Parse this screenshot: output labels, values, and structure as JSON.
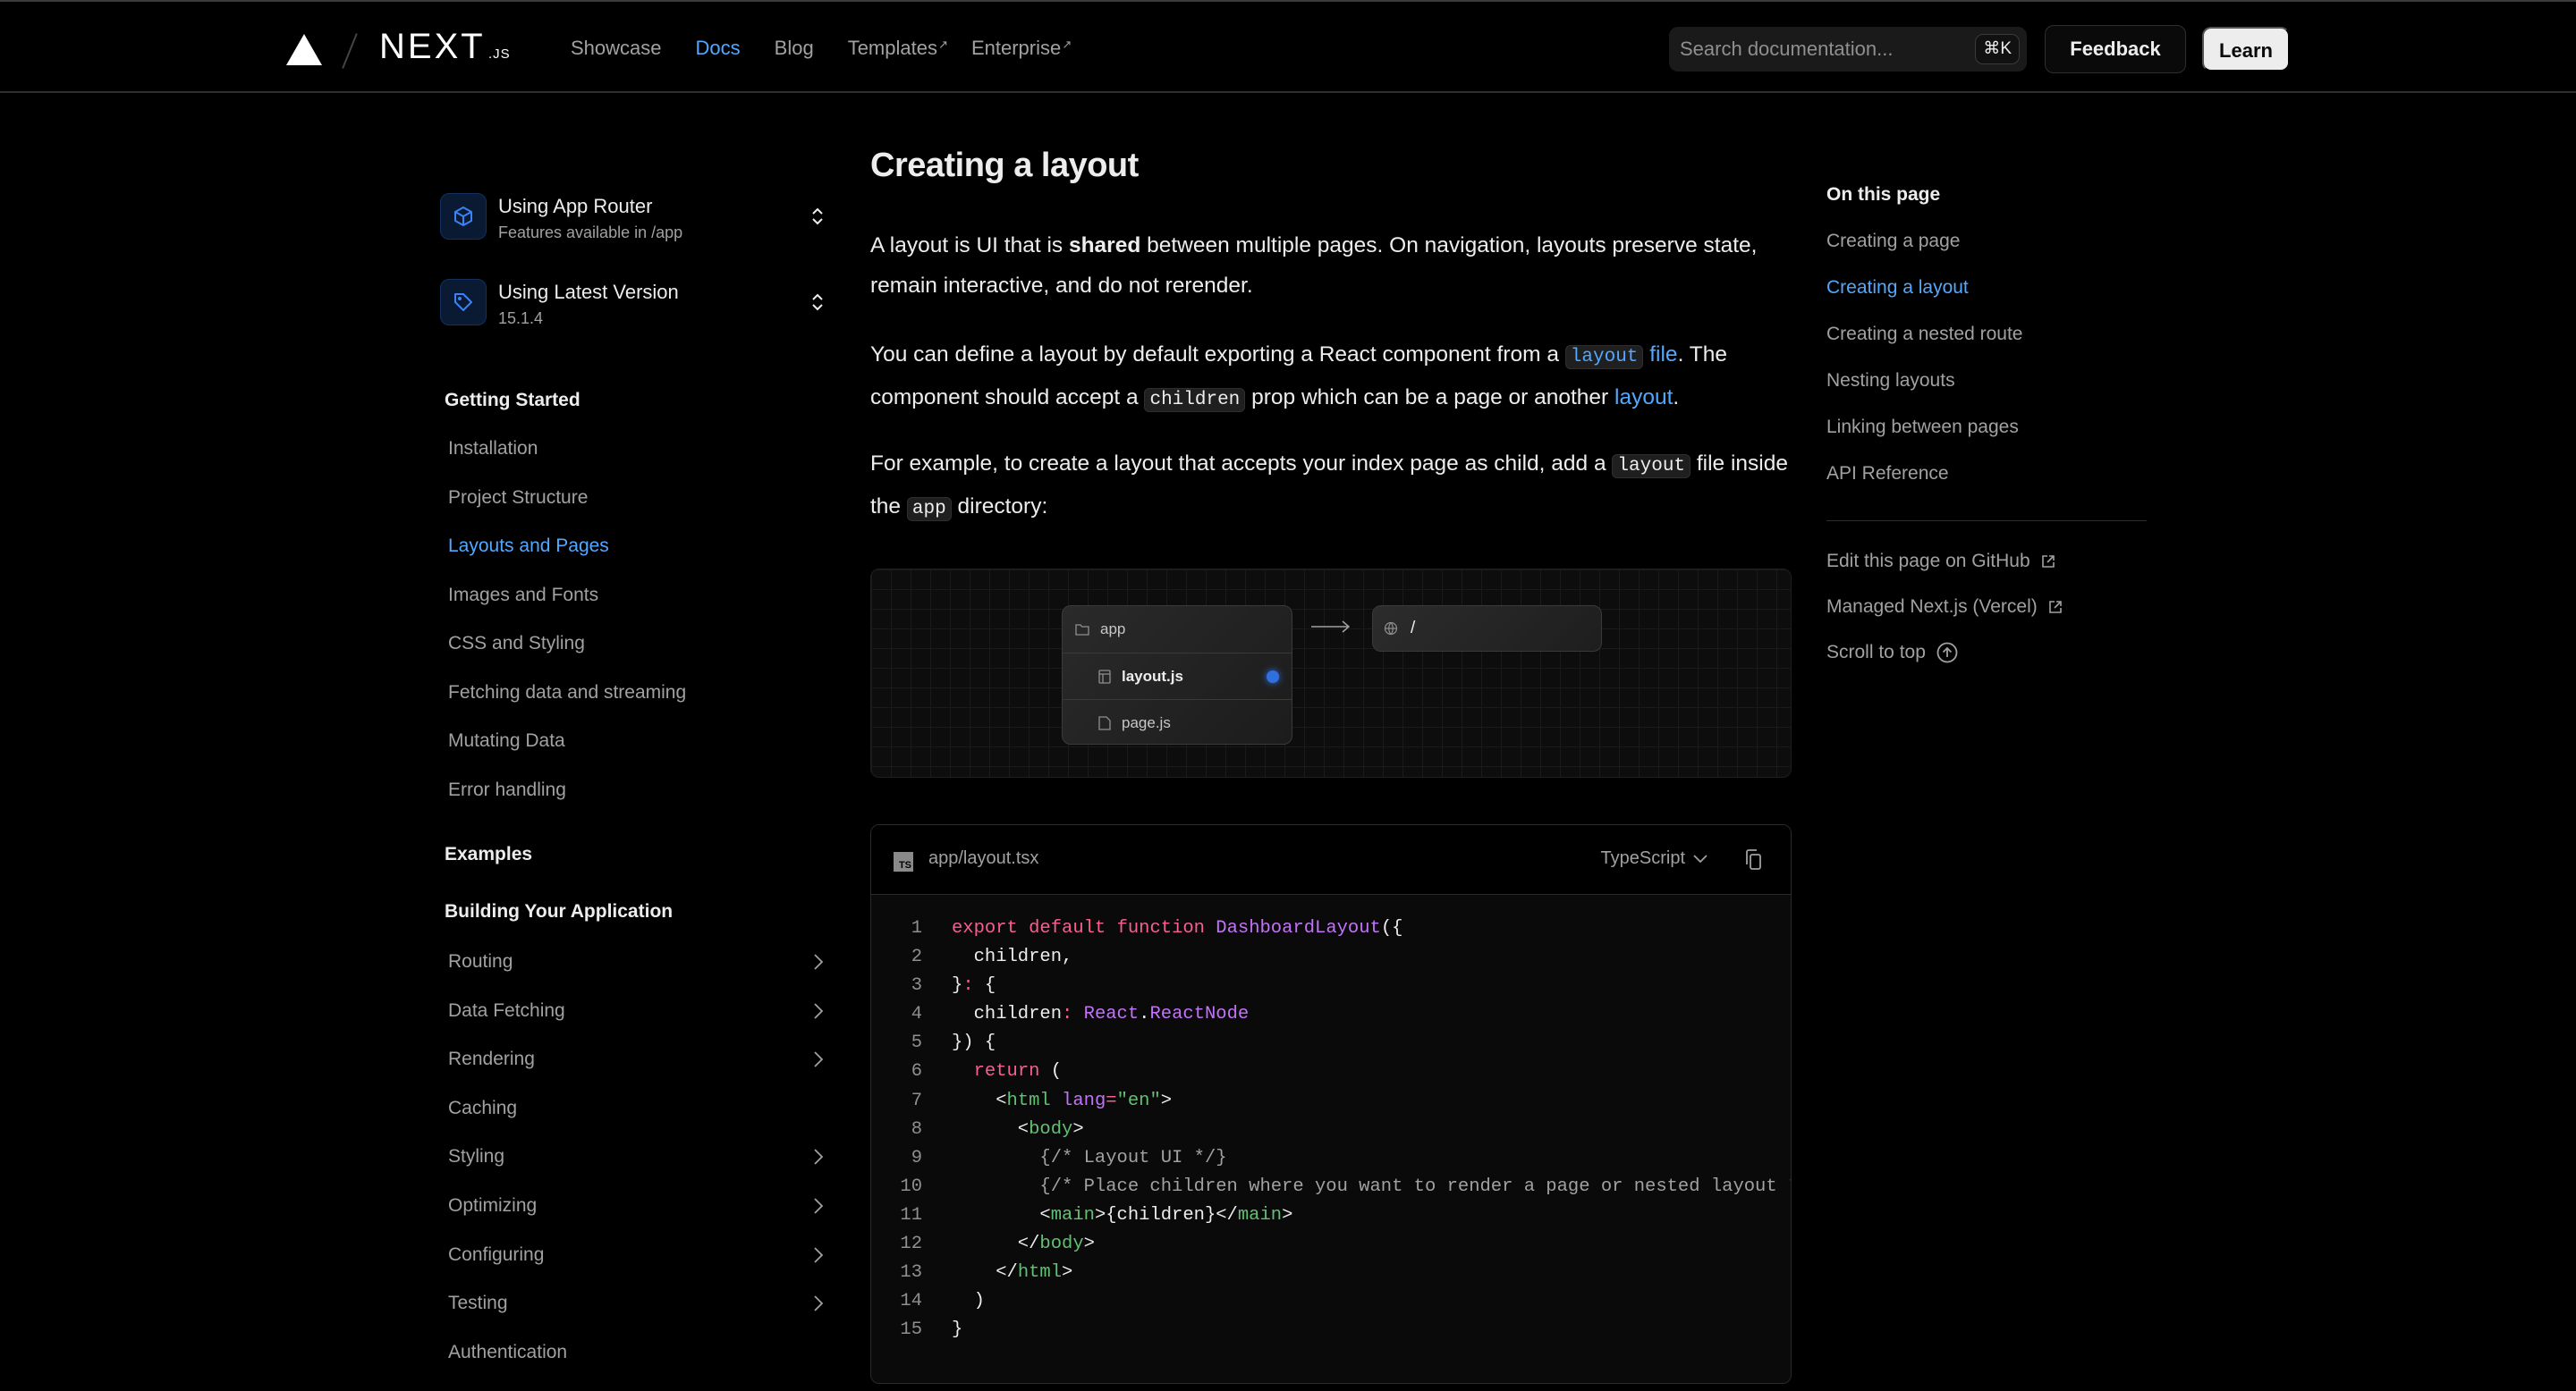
{
  "header": {
    "logo_text": "NEXT",
    "logo_suffix": ".JS",
    "nav": [
      {
        "label": "Showcase",
        "active": false,
        "external": false
      },
      {
        "label": "Docs",
        "active": true,
        "external": false
      },
      {
        "label": "Blog",
        "active": false,
        "external": false
      },
      {
        "label": "Templates",
        "active": false,
        "external": true
      },
      {
        "label": "Enterprise",
        "active": false,
        "external": true
      }
    ],
    "external_glyph": "↗",
    "search_placeholder": "Search documentation...",
    "search_shortcut": "⌘K",
    "feedback_label": "Feedback",
    "learn_label": "Learn"
  },
  "sidebar": {
    "router_switcher": {
      "title": "Using App Router",
      "subtitle": "Features available in /app",
      "icon": "cube-icon"
    },
    "version_switcher": {
      "title": "Using Latest Version",
      "subtitle": "15.1.4",
      "icon": "tag-icon"
    },
    "sections": [
      {
        "heading": "Getting Started",
        "items": [
          {
            "label": "Installation",
            "active": false,
            "expandable": false
          },
          {
            "label": "Project Structure",
            "active": false,
            "expandable": false
          },
          {
            "label": "Layouts and Pages",
            "active": true,
            "expandable": false
          },
          {
            "label": "Images and Fonts",
            "active": false,
            "expandable": false
          },
          {
            "label": "CSS and Styling",
            "active": false,
            "expandable": false
          },
          {
            "label": "Fetching data and streaming",
            "active": false,
            "expandable": false
          },
          {
            "label": "Mutating Data",
            "active": false,
            "expandable": false
          },
          {
            "label": "Error handling",
            "active": false,
            "expandable": false
          }
        ]
      },
      {
        "heading": "Examples",
        "items": []
      },
      {
        "heading": "Building Your Application",
        "items": [
          {
            "label": "Routing",
            "active": false,
            "expandable": true
          },
          {
            "label": "Data Fetching",
            "active": false,
            "expandable": true
          },
          {
            "label": "Rendering",
            "active": false,
            "expandable": true
          },
          {
            "label": "Caching",
            "active": false,
            "expandable": false
          },
          {
            "label": "Styling",
            "active": false,
            "expandable": true
          },
          {
            "label": "Optimizing",
            "active": false,
            "expandable": true
          },
          {
            "label": "Configuring",
            "active": false,
            "expandable": true
          },
          {
            "label": "Testing",
            "active": false,
            "expandable": true
          },
          {
            "label": "Authentication",
            "active": false,
            "expandable": false
          }
        ]
      }
    ]
  },
  "main": {
    "heading": "Creating a layout",
    "p1": {
      "before": "A layout is UI that is ",
      "bold": "shared",
      "after": " between multiple pages. On navigation, layouts preserve state, remain interactive, and do not rerender."
    },
    "p2": {
      "t1": "You can define a layout by default exporting a React component from a ",
      "code1": "layout",
      "link1": "file",
      "t2": ". The component should accept a ",
      "code2": "children",
      "t3": " prop which can be a page or another ",
      "link2": "layout",
      "t4": "."
    },
    "p3": {
      "t1": "For example, to create a layout that accepts your index page as child, add a ",
      "code1": "layout",
      "t2": " file inside the ",
      "code2": "app",
      "t3": " directory:"
    },
    "diagram": {
      "folder": "app",
      "files": [
        {
          "name": "layout.js",
          "highlighted": true,
          "icon": "layout-file-icon"
        },
        {
          "name": "page.js",
          "highlighted": false,
          "icon": "file-icon"
        }
      ],
      "route": "/",
      "accent": "#2f6fe0"
    },
    "code": {
      "badge": "TS",
      "filename": "app/layout.tsx",
      "language": "TypeScript",
      "lines": [
        "export default function DashboardLayout({",
        "  children,",
        "}: {",
        "  children: React.ReactNode",
        "}) {",
        "  return (",
        "    <html lang=\"en\">",
        "      <body>",
        "        {/* Layout UI */}",
        "        {/* Place children where you want to render a page or nested layout */}",
        "        <main>{children}</main>",
        "      </body>",
        "    </html>",
        "  )",
        "}"
      ]
    }
  },
  "toc": {
    "title": "On this page",
    "items": [
      {
        "label": "Creating a page",
        "active": false
      },
      {
        "label": "Creating a layout",
        "active": true
      },
      {
        "label": "Creating a nested route",
        "active": false
      },
      {
        "label": "Nesting layouts",
        "active": false
      },
      {
        "label": "Linking between pages",
        "active": false
      },
      {
        "label": "API Reference",
        "active": false
      }
    ],
    "links": [
      {
        "label": "Edit this page on GitHub",
        "icon": "external-link-icon"
      },
      {
        "label": "Managed Next.js (Vercel)",
        "icon": "external-link-icon"
      },
      {
        "label": "Scroll to top",
        "icon": "arrow-up-circle-icon"
      }
    ]
  },
  "colors": {
    "accent": "#52a8ff",
    "background": "#000000",
    "text": "#ededed",
    "muted": "#a1a1a1"
  }
}
